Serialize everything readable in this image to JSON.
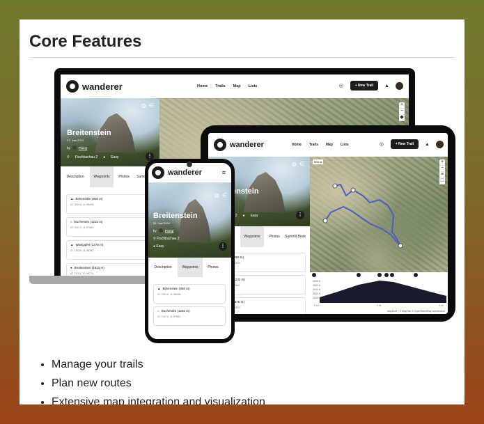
{
  "section_title": "Core Features",
  "app": {
    "brand": "wanderer",
    "nav": [
      "Home",
      "Trails",
      "Map",
      "Lists"
    ],
    "new_trail": "+ New Trail"
  },
  "trail": {
    "title": "Breitenstein",
    "date": "31. Juni 2024",
    "by": "by",
    "author": "Flomp",
    "location": "Fischbachau 2",
    "difficulty": "Easy"
  },
  "tabs": [
    "Description",
    "Waypoints",
    "Photos",
    "Summit Book"
  ],
  "waypoints": [
    {
      "name": "Birkenstein (850 m)",
      "coords": "47.75216, 11.96498"
    },
    {
      "name": "Bucheralm (1232 m)",
      "coords": "47.72473, 11.97681"
    },
    {
      "name": "Waxlgipfel (1375 m)",
      "coords": "47.73520, 11.98283"
    },
    {
      "name": "Breitenstein (1622 m)",
      "coords": "47.73011, 11.98774"
    }
  ],
  "tablet_waypoints": [
    {
      "name": "Birkenstein (850 m)",
      "coords": "47.75216, 11.96498"
    },
    {
      "name": "Bucheralm (1232 m)",
      "coords": "47.72473, 11.97681"
    },
    {
      "name": "Waxlgipfel (1375 m)",
      "coords": "47.73520, 11.98283"
    }
  ],
  "map": {
    "scale": "500 m",
    "attribution": "MapLibre | © MapTiler © OpenStreetMap contributors",
    "elevation_ticks": [
      "2000 ft",
      "4500 ft",
      "4000 ft",
      "3500 ft",
      "3000 ft"
    ],
    "x_ticks": [
      "0 mi",
      "1 mi",
      "2 mi"
    ]
  },
  "features": [
    "Manage your trails",
    "Plan new routes",
    "Extensive map integration and visualization"
  ],
  "colors": {
    "route": "#4a5fc2",
    "elevation_fill": "#1a1a2e",
    "button": "#1d1d1d"
  }
}
